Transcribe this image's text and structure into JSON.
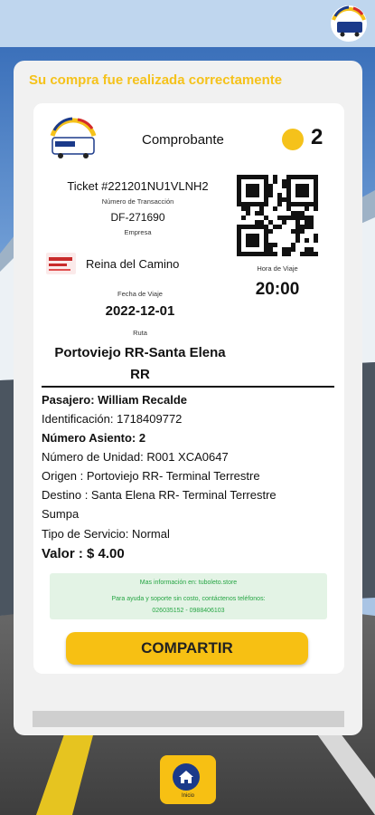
{
  "success_message": "Su compra fue realizada correctamente",
  "receipt": {
    "title": "Comprobante",
    "seat_badge": "2",
    "ticket_number": "Ticket #221201NU1VLNH2",
    "transaction_label": "Número de Transacción",
    "transaction_value": "DF-271690",
    "company_label": "Empresa",
    "company_name": "Reina del Camino",
    "date_label": "Fecha de Viaje",
    "date_value": "2022-12-01",
    "route_label": "Ruta",
    "route_value": "Portoviejo RR-Santa Elena RR",
    "time_label": "Hora de Viaje",
    "time_value": "20:00"
  },
  "passenger": {
    "name": "Pasajero: William Recalde",
    "id": "Identificación: 1718409772",
    "seat": "Número Asiento: 2",
    "unit": "Número de Unidad: R001 XCA0647",
    "origin": "Origen : Portoviejo RR- Terminal Terrestre",
    "destination_line1": "Destino : Santa Elena RR- Terminal Terrestre",
    "destination_line2": "Sumpa",
    "service": "Tipo de Servicio: Normal",
    "value": "Valor : $ 4.00"
  },
  "support": {
    "info": "Mas información en: tuboleto.store",
    "help": "Para ayuda y soporte sin costo, contáctenos teléfonos:",
    "phones": "026035152 - 0988406103"
  },
  "share_label": "COMPARTIR",
  "nav": {
    "home_label": "Inicio"
  },
  "colors": {
    "accent": "#f7c013",
    "nav_icon": "#1b3a8a",
    "support_text": "#26a544"
  }
}
